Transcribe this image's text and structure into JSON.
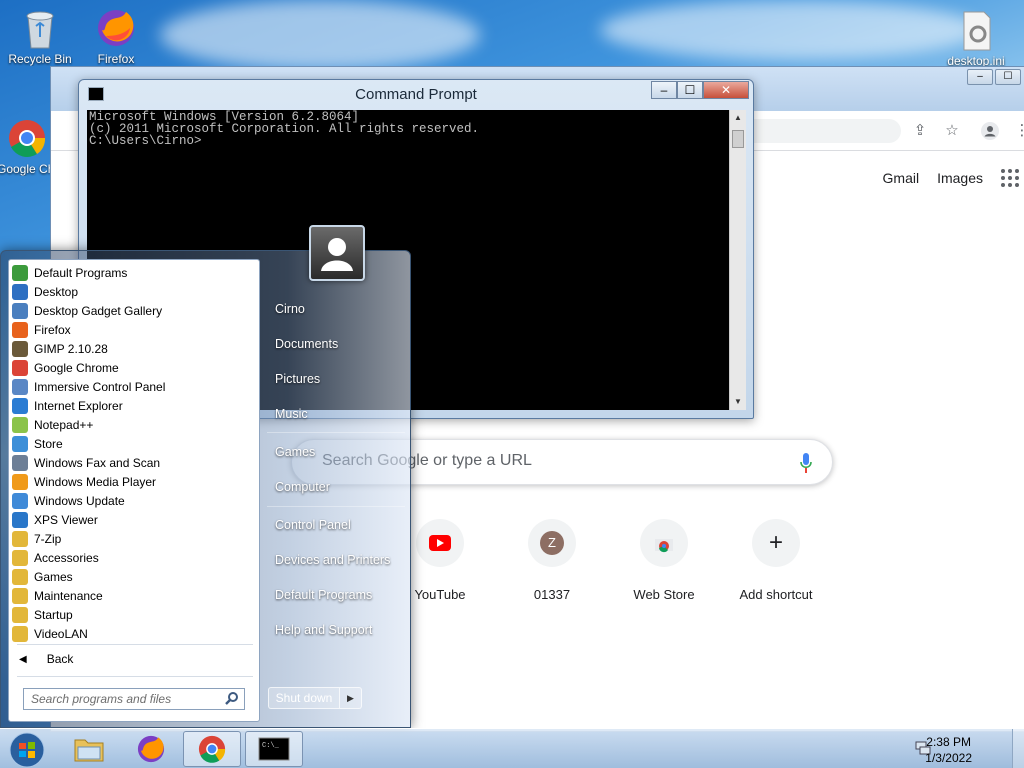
{
  "desktop": {
    "icons": [
      {
        "label": "Recycle Bin",
        "icon": "recycle-bin-icon"
      },
      {
        "label": "Firefox",
        "icon": "firefox-icon"
      },
      {
        "label": "Google Chrome",
        "icon": "chrome-icon"
      },
      {
        "label": "desktop.ini",
        "icon": "settings-file-icon"
      }
    ]
  },
  "chrome_window": {
    "top_links": {
      "gmail": "Gmail",
      "images": "Images"
    },
    "search": {
      "placeholder": "Search Google or type a URL"
    },
    "shortcuts": [
      {
        "label": "YouTube",
        "letter": ""
      },
      {
        "label": "01337",
        "letter": "Z"
      },
      {
        "label": "Web Store",
        "letter": ""
      },
      {
        "label": "Add shortcut",
        "letter": "+"
      }
    ]
  },
  "cmd_window": {
    "title": "Command Prompt",
    "lines": [
      "Microsoft Windows [Version 6.2.8064]",
      "(c) 2011 Microsoft Corporation. All rights reserved.",
      "",
      "C:\\Users\\Cirno>"
    ],
    "controls": {
      "minimize": "–",
      "maximize": "☐",
      "close": "✕"
    }
  },
  "start_menu": {
    "programs": [
      {
        "label": "Default Programs",
        "color": "#3c9b3c"
      },
      {
        "label": "Desktop",
        "color": "#2d6fc2"
      },
      {
        "label": "Desktop Gadget Gallery",
        "color": "#4a7fbf"
      },
      {
        "label": "Firefox",
        "color": "#e8621c"
      },
      {
        "label": "GIMP 2.10.28",
        "color": "#6b5a3a"
      },
      {
        "label": "Google Chrome",
        "color": "#db4437"
      },
      {
        "label": "Immersive Control Panel",
        "color": "#5a87c5"
      },
      {
        "label": "Internet Explorer",
        "color": "#2b7cd3"
      },
      {
        "label": "Notepad++",
        "color": "#8bc34a"
      },
      {
        "label": "Store",
        "color": "#3d8fd8"
      },
      {
        "label": "Windows Fax and Scan",
        "color": "#6d7f96"
      },
      {
        "label": "Windows Media Player",
        "color": "#f09a1a"
      },
      {
        "label": "Windows Update",
        "color": "#3f8ad8"
      },
      {
        "label": "XPS Viewer",
        "color": "#2a77c9"
      },
      {
        "label": "7-Zip",
        "color": "#e2b73a"
      },
      {
        "label": "Accessories",
        "color": "#e2b73a"
      },
      {
        "label": "Games",
        "color": "#e2b73a"
      },
      {
        "label": "Maintenance",
        "color": "#e2b73a"
      },
      {
        "label": "Startup",
        "color": "#e2b73a"
      },
      {
        "label": "VideoLAN",
        "color": "#e2b73a"
      }
    ],
    "back": "Back",
    "search_placeholder": "Search programs and files",
    "right_items": {
      "user": "Cirno",
      "documents": "Documents",
      "pictures": "Pictures",
      "music": "Music",
      "games": "Games",
      "computer": "Computer",
      "control_panel": "Control Panel",
      "devices": "Devices and Printers",
      "default_programs": "Default Programs",
      "help": "Help and Support"
    },
    "shutdown": "Shut down"
  },
  "taskbar": {
    "buttons": [
      "file-explorer-icon",
      "firefox-icon",
      "chrome-icon",
      "command-prompt-icon"
    ],
    "time": "2:38 PM",
    "date": "1/3/2022"
  }
}
